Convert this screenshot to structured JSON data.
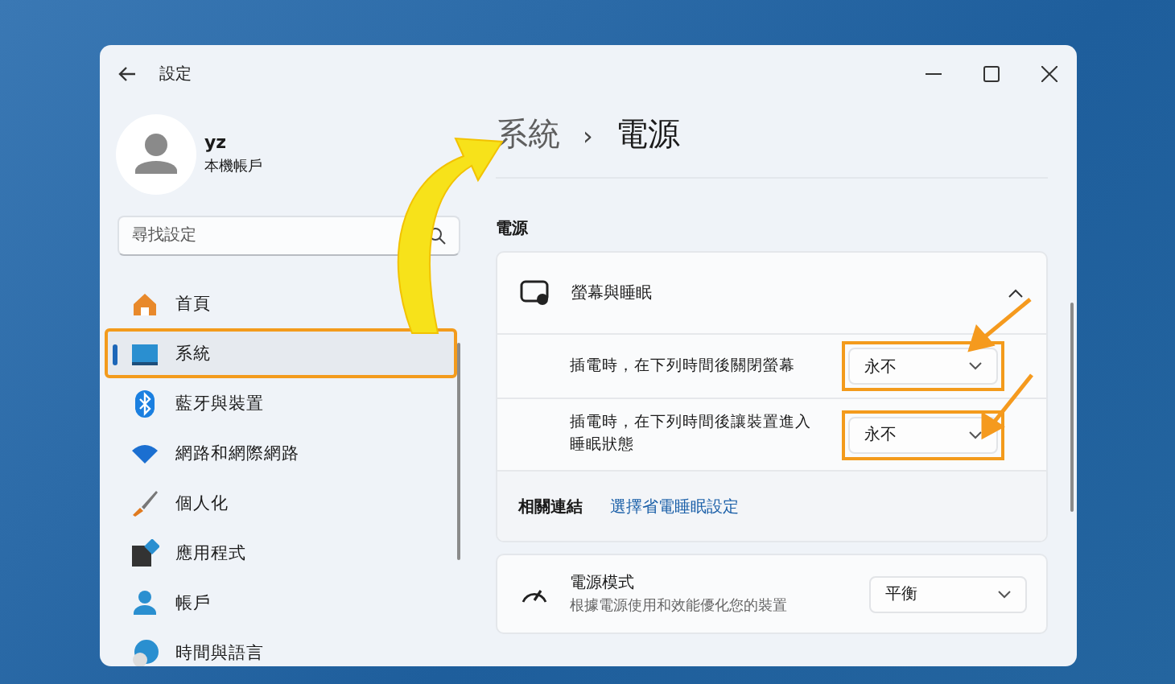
{
  "window": {
    "title": "設定"
  },
  "profile": {
    "name": "yz",
    "account": "本機帳戶"
  },
  "search": {
    "placeholder": "尋找設定"
  },
  "sidebar": {
    "items": [
      {
        "label": "首頁",
        "kind": "home",
        "selected": false,
        "highlighted": false
      },
      {
        "label": "系統",
        "kind": "system",
        "selected": true,
        "highlighted": true
      },
      {
        "label": "藍牙與裝置",
        "kind": "bluetooth",
        "selected": false,
        "highlighted": false
      },
      {
        "label": "網路和網際網路",
        "kind": "network",
        "selected": false,
        "highlighted": false
      },
      {
        "label": "個人化",
        "kind": "personalization",
        "selected": false,
        "highlighted": false
      },
      {
        "label": "應用程式",
        "kind": "apps",
        "selected": false,
        "highlighted": false
      },
      {
        "label": "帳戶",
        "kind": "account",
        "selected": false,
        "highlighted": false
      },
      {
        "label": "時間與語言",
        "kind": "time",
        "selected": false,
        "highlighted": false
      }
    ]
  },
  "breadcrumb": {
    "parent": "系統",
    "separator": "›",
    "current": "電源"
  },
  "section": {
    "title": "電源"
  },
  "screen_sleep": {
    "title": "螢幕與睡眠",
    "expanded": true,
    "rows": [
      {
        "label": "插電時，在下列時間後關閉螢幕",
        "value": "永不",
        "highlighted": true
      },
      {
        "label": "插電時，在下列時間後讓裝置進入睡眠狀態",
        "value": "永不",
        "highlighted": true
      }
    ],
    "related": {
      "label": "相關連結",
      "link": "選擇省電睡眠設定"
    }
  },
  "power_mode": {
    "title": "電源模式",
    "description": "根據電源使用和效能優化您的裝置",
    "value": "平衡"
  }
}
